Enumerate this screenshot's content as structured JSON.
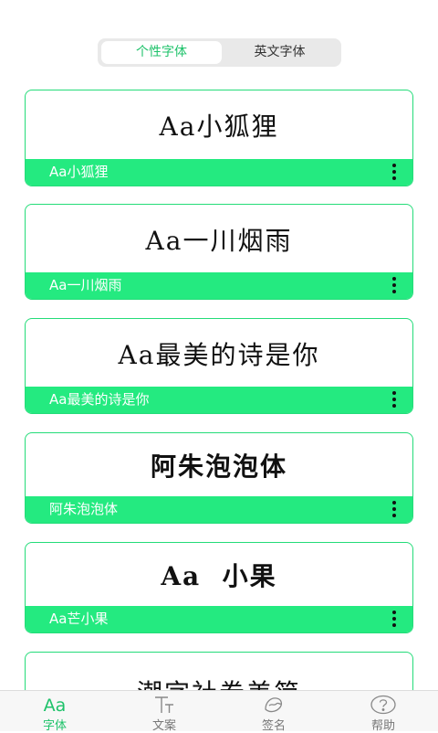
{
  "segment": {
    "tabs": [
      "个性字体",
      "英文字体"
    ],
    "active_index": 0
  },
  "fonts": [
    {
      "preview": "Aa小狐狸",
      "name": "Aa小狐狸"
    },
    {
      "preview": "Aa一川烟雨",
      "name": "Aa一川烟雨"
    },
    {
      "preview": "Aa最美的诗是你",
      "name": "Aa最美的诗是你"
    },
    {
      "preview": "阿朱泡泡体",
      "name": "阿朱泡泡体"
    },
    {
      "preview": "Aa  小果",
      "name": "Aa芒小果"
    },
    {
      "preview": "潮字社卷美简",
      "name": ""
    }
  ],
  "tabbar": {
    "items": [
      {
        "label": "字体",
        "icon": "font-aa-icon"
      },
      {
        "label": "文案",
        "icon": "text-t-icon"
      },
      {
        "label": "签名",
        "icon": "signature-icon"
      },
      {
        "label": "帮助",
        "icon": "help-icon"
      }
    ],
    "active_index": 0
  },
  "colors": {
    "accent": "#24ea80",
    "active_text": "#1ec26a",
    "card_border": "#24dc79"
  }
}
